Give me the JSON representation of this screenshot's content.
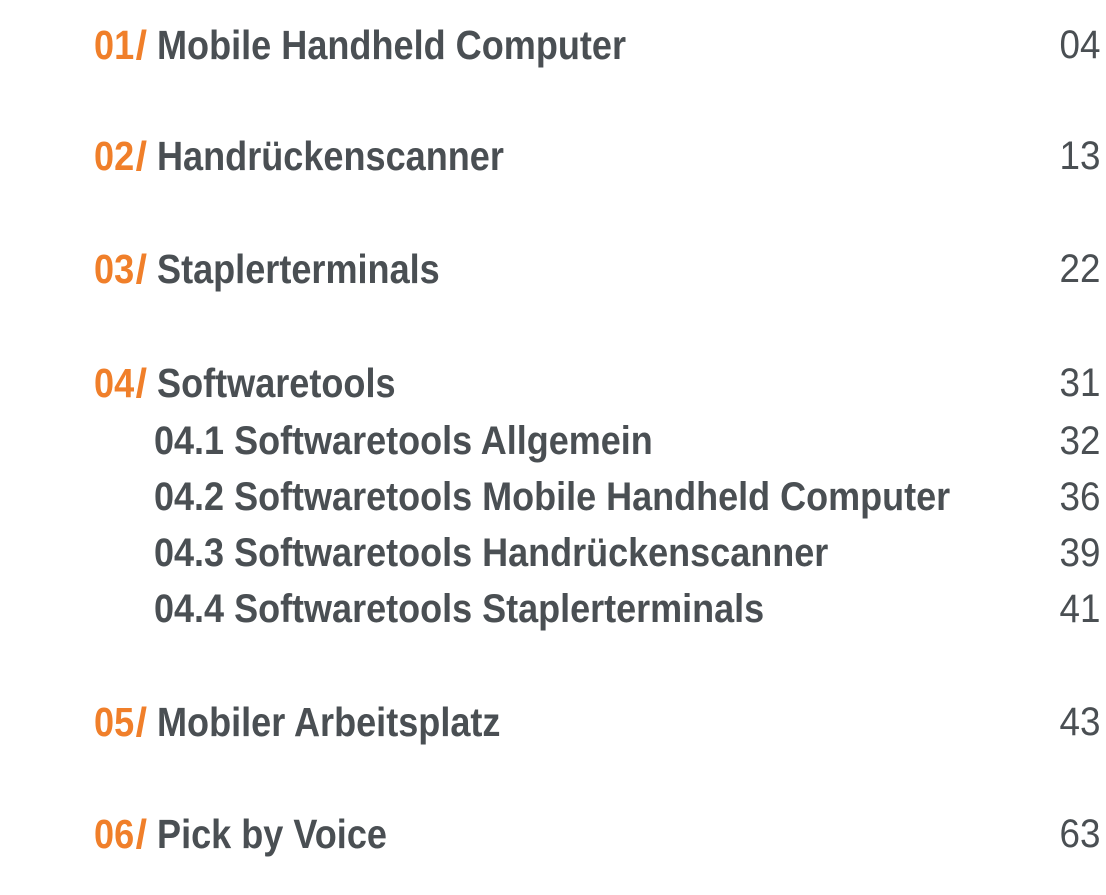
{
  "toc": {
    "items": [
      {
        "number": "01",
        "label": "Mobile Handheld Computer",
        "page": "04"
      },
      {
        "number": "02",
        "label": "Handrückenscanner",
        "page": "13"
      },
      {
        "number": "03",
        "label": "Staplerterminals",
        "page": "22"
      },
      {
        "number": "04",
        "label": "Softwaretools",
        "page": "31"
      },
      {
        "label": "04.1 Softwaretools Allgemein",
        "page": "32"
      },
      {
        "label": "04.2 Softwaretools Mobile Handheld Computer",
        "page": "36"
      },
      {
        "label": "04.3 Softwaretools Handrückenscanner",
        "page": "39"
      },
      {
        "label": "04.4 Softwaretools Staplerterminals",
        "page": "41"
      },
      {
        "number": "05",
        "label": "Mobiler Arbeitsplatz",
        "page": "43"
      },
      {
        "number": "06",
        "label": "Pick by Voice",
        "page": "63"
      }
    ],
    "separator": "/",
    "accent_color": "#f07f2a",
    "text_color": "#4a4f53"
  }
}
